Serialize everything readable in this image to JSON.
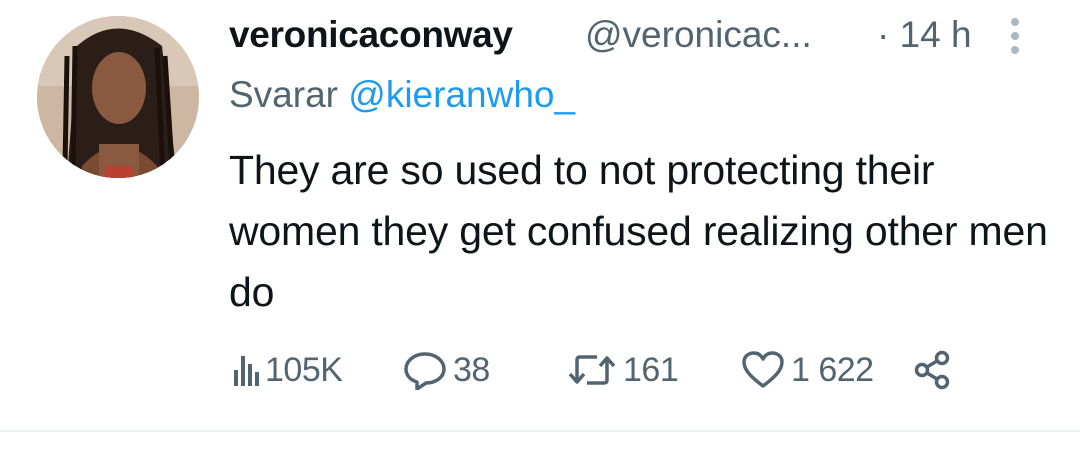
{
  "tweet": {
    "display_name": "veronicaconway",
    "handle": "@veronicac...",
    "time": "· 14 h",
    "reply_prefix": "Svarar ",
    "reply_to": "@kieranwho_",
    "text": "They are so used to not protecting their women they get confused realizing other men do",
    "stats": {
      "views": "105K",
      "replies": "38",
      "retweets": "161",
      "likes": "1 622"
    }
  },
  "colors": {
    "text_primary": "#0f1419",
    "text_secondary": "#536471",
    "link": "#1d9bf0"
  },
  "icons": [
    "views-icon",
    "reply-icon",
    "retweet-icon",
    "like-icon",
    "share-icon",
    "more-icon"
  ]
}
